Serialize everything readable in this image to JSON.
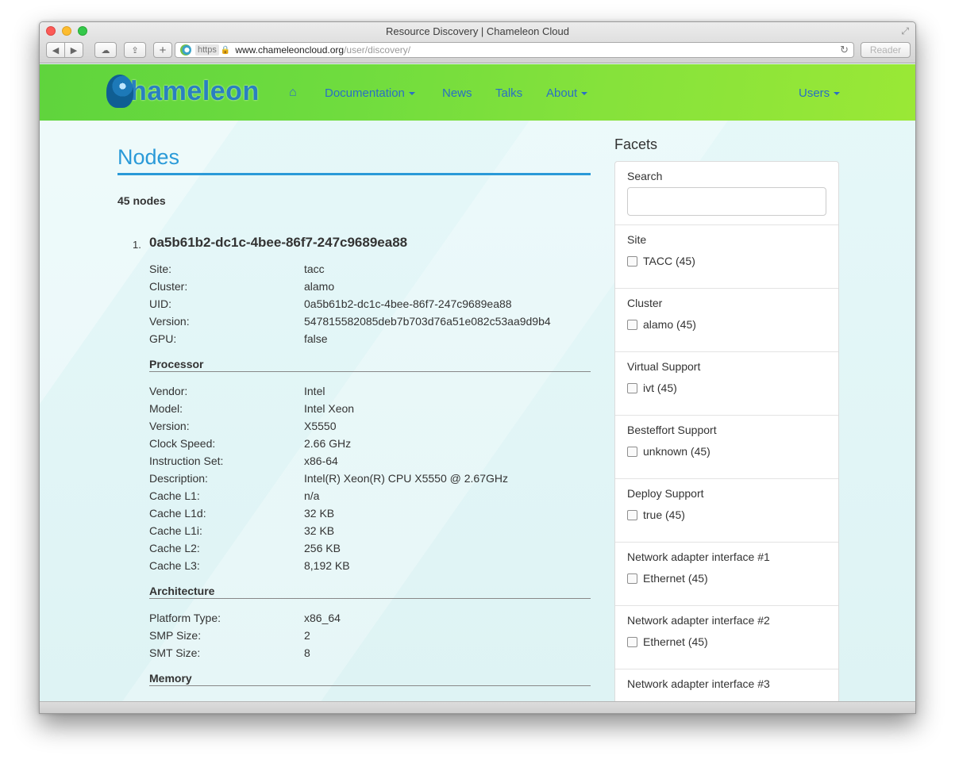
{
  "window": {
    "title": "Resource Discovery | Chameleon Cloud"
  },
  "toolbar": {
    "back_label": "◀",
    "forward_label": "▶",
    "cloud_label": "☁",
    "share_label": "⇪",
    "add_label": "+",
    "url_scheme": "https",
    "url_host": "www.chameleoncloud.org",
    "url_path": "/user/discovery/",
    "reader_label": "Reader"
  },
  "nav": {
    "logo_text": "hameleon",
    "home_icon": "home-icon",
    "documentation": "Documentation",
    "news": "News",
    "talks": "Talks",
    "about": "About",
    "users": "Users"
  },
  "main": {
    "title": "Nodes",
    "count": "45 nodes",
    "node": {
      "number": "1.",
      "id": "0a5b61b2-dc1c-4bee-86f7-247c9689ea88",
      "general": [
        {
          "key": "Site:",
          "value": "tacc"
        },
        {
          "key": "Cluster:",
          "value": "alamo"
        },
        {
          "key": "UID:",
          "value": "0a5b61b2-dc1c-4bee-86f7-247c9689ea88"
        },
        {
          "key": "Version:",
          "value": "547815582085deb7b703d76a51e082c53aa9d9b4"
        },
        {
          "key": "GPU:",
          "value": "false"
        }
      ],
      "processor_title": "Processor",
      "processor": [
        {
          "key": "Vendor:",
          "value": "Intel"
        },
        {
          "key": "Model:",
          "value": "Intel Xeon"
        },
        {
          "key": "Version:",
          "value": "X5550"
        },
        {
          "key": "Clock Speed:",
          "value": "2.66 GHz"
        },
        {
          "key": "Instruction Set:",
          "value": "x86-64"
        },
        {
          "key": "Description:",
          "value": "Intel(R) Xeon(R) CPU X5550 @ 2.67GHz"
        },
        {
          "key": "Cache L1:",
          "value": "n/a"
        },
        {
          "key": "Cache L1d:",
          "value": "32 KB"
        },
        {
          "key": "Cache L1i:",
          "value": "32 KB"
        },
        {
          "key": "Cache L2:",
          "value": "256 KB"
        },
        {
          "key": "Cache L3:",
          "value": "8,192 KB"
        }
      ],
      "architecture_title": "Architecture",
      "architecture": [
        {
          "key": "Platform Type:",
          "value": "x86_64"
        },
        {
          "key": "SMP Size:",
          "value": "2"
        },
        {
          "key": "SMT Size:",
          "value": "8"
        }
      ],
      "memory_title": "Memory"
    }
  },
  "facets": {
    "title": "Facets",
    "search_label": "Search",
    "search_value": "",
    "groups": [
      {
        "label": "Site",
        "option": "TACC (45)"
      },
      {
        "label": "Cluster",
        "option": "alamo (45)"
      },
      {
        "label": "Virtual Support",
        "option": "ivt (45)"
      },
      {
        "label": "Besteffort Support",
        "option": "unknown (45)"
      },
      {
        "label": "Deploy Support",
        "option": "true (45)"
      },
      {
        "label": "Network adapter interface #1",
        "option": "Ethernet (45)"
      },
      {
        "label": "Network adapter interface #2",
        "option": "Ethernet (45)"
      },
      {
        "label": "Network adapter interface #3",
        "option": ""
      }
    ]
  }
}
